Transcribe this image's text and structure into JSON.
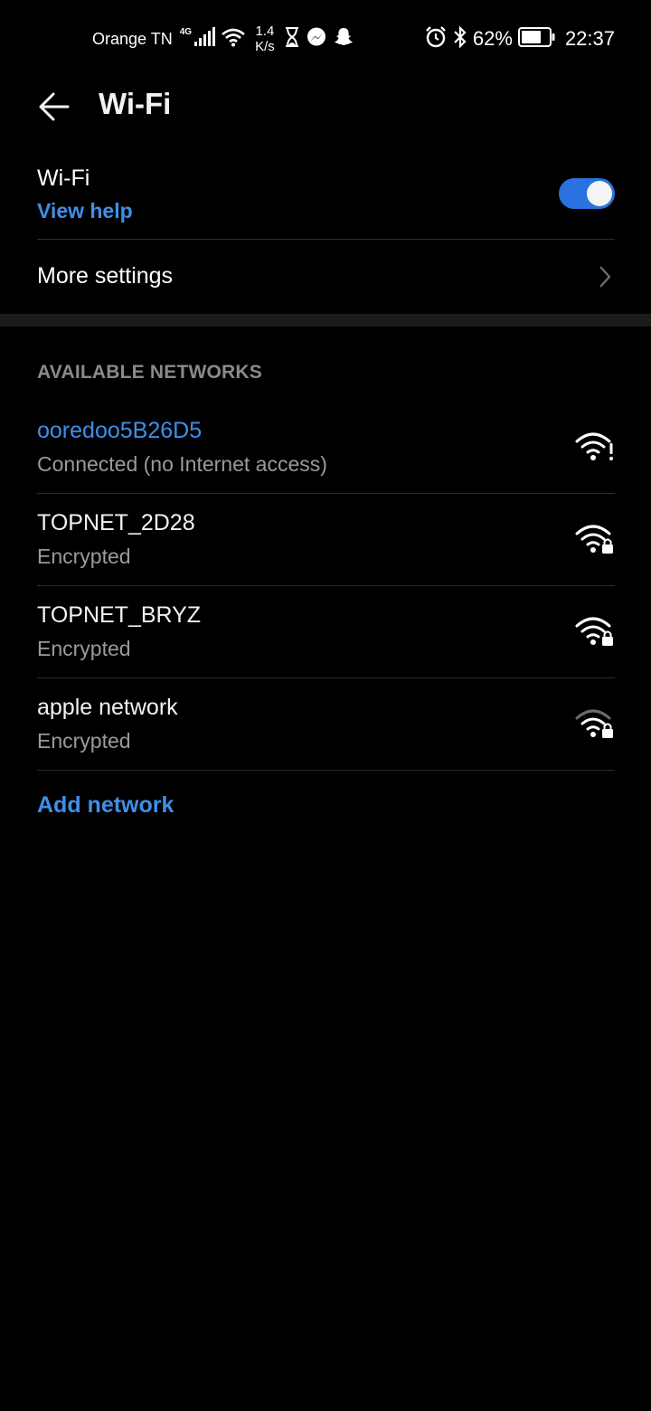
{
  "status_bar": {
    "carrier": "Orange TN",
    "network_type": "4G",
    "speed_value": "1.4",
    "speed_unit": "K/s",
    "battery_percent": "62%",
    "time": "22:37",
    "icons": [
      "signal-icon",
      "wifi-icon",
      "hourglass-icon",
      "messenger-icon",
      "snapchat-icon",
      "alarm-icon",
      "bluetooth-icon",
      "battery-icon"
    ]
  },
  "header": {
    "title": "Wi-Fi"
  },
  "wifi_toggle": {
    "label": "Wi-Fi",
    "help_link": "View help",
    "enabled": true,
    "accent_color": "#2a72df"
  },
  "more_settings": {
    "label": "More settings"
  },
  "networks": {
    "section_title": "AVAILABLE NETWORKS",
    "items": [
      {
        "name": "ooredoo5B26D5",
        "status": "Connected (no Internet access)",
        "connected": true,
        "icon": "wifi-warning-icon"
      },
      {
        "name": "TOPNET_2D28",
        "status": "Encrypted",
        "connected": false,
        "icon": "wifi-lock-icon"
      },
      {
        "name": "TOPNET_BRYZ",
        "status": "Encrypted",
        "connected": false,
        "icon": "wifi-lock-icon"
      },
      {
        "name": "apple network",
        "status": "Encrypted",
        "connected": false,
        "icon": "wifi-lock-weak-icon"
      }
    ],
    "add_network": "Add network"
  },
  "colors": {
    "background": "#000000",
    "link_blue": "#3f8fe8",
    "secondary_text": "#9a9a9a"
  }
}
